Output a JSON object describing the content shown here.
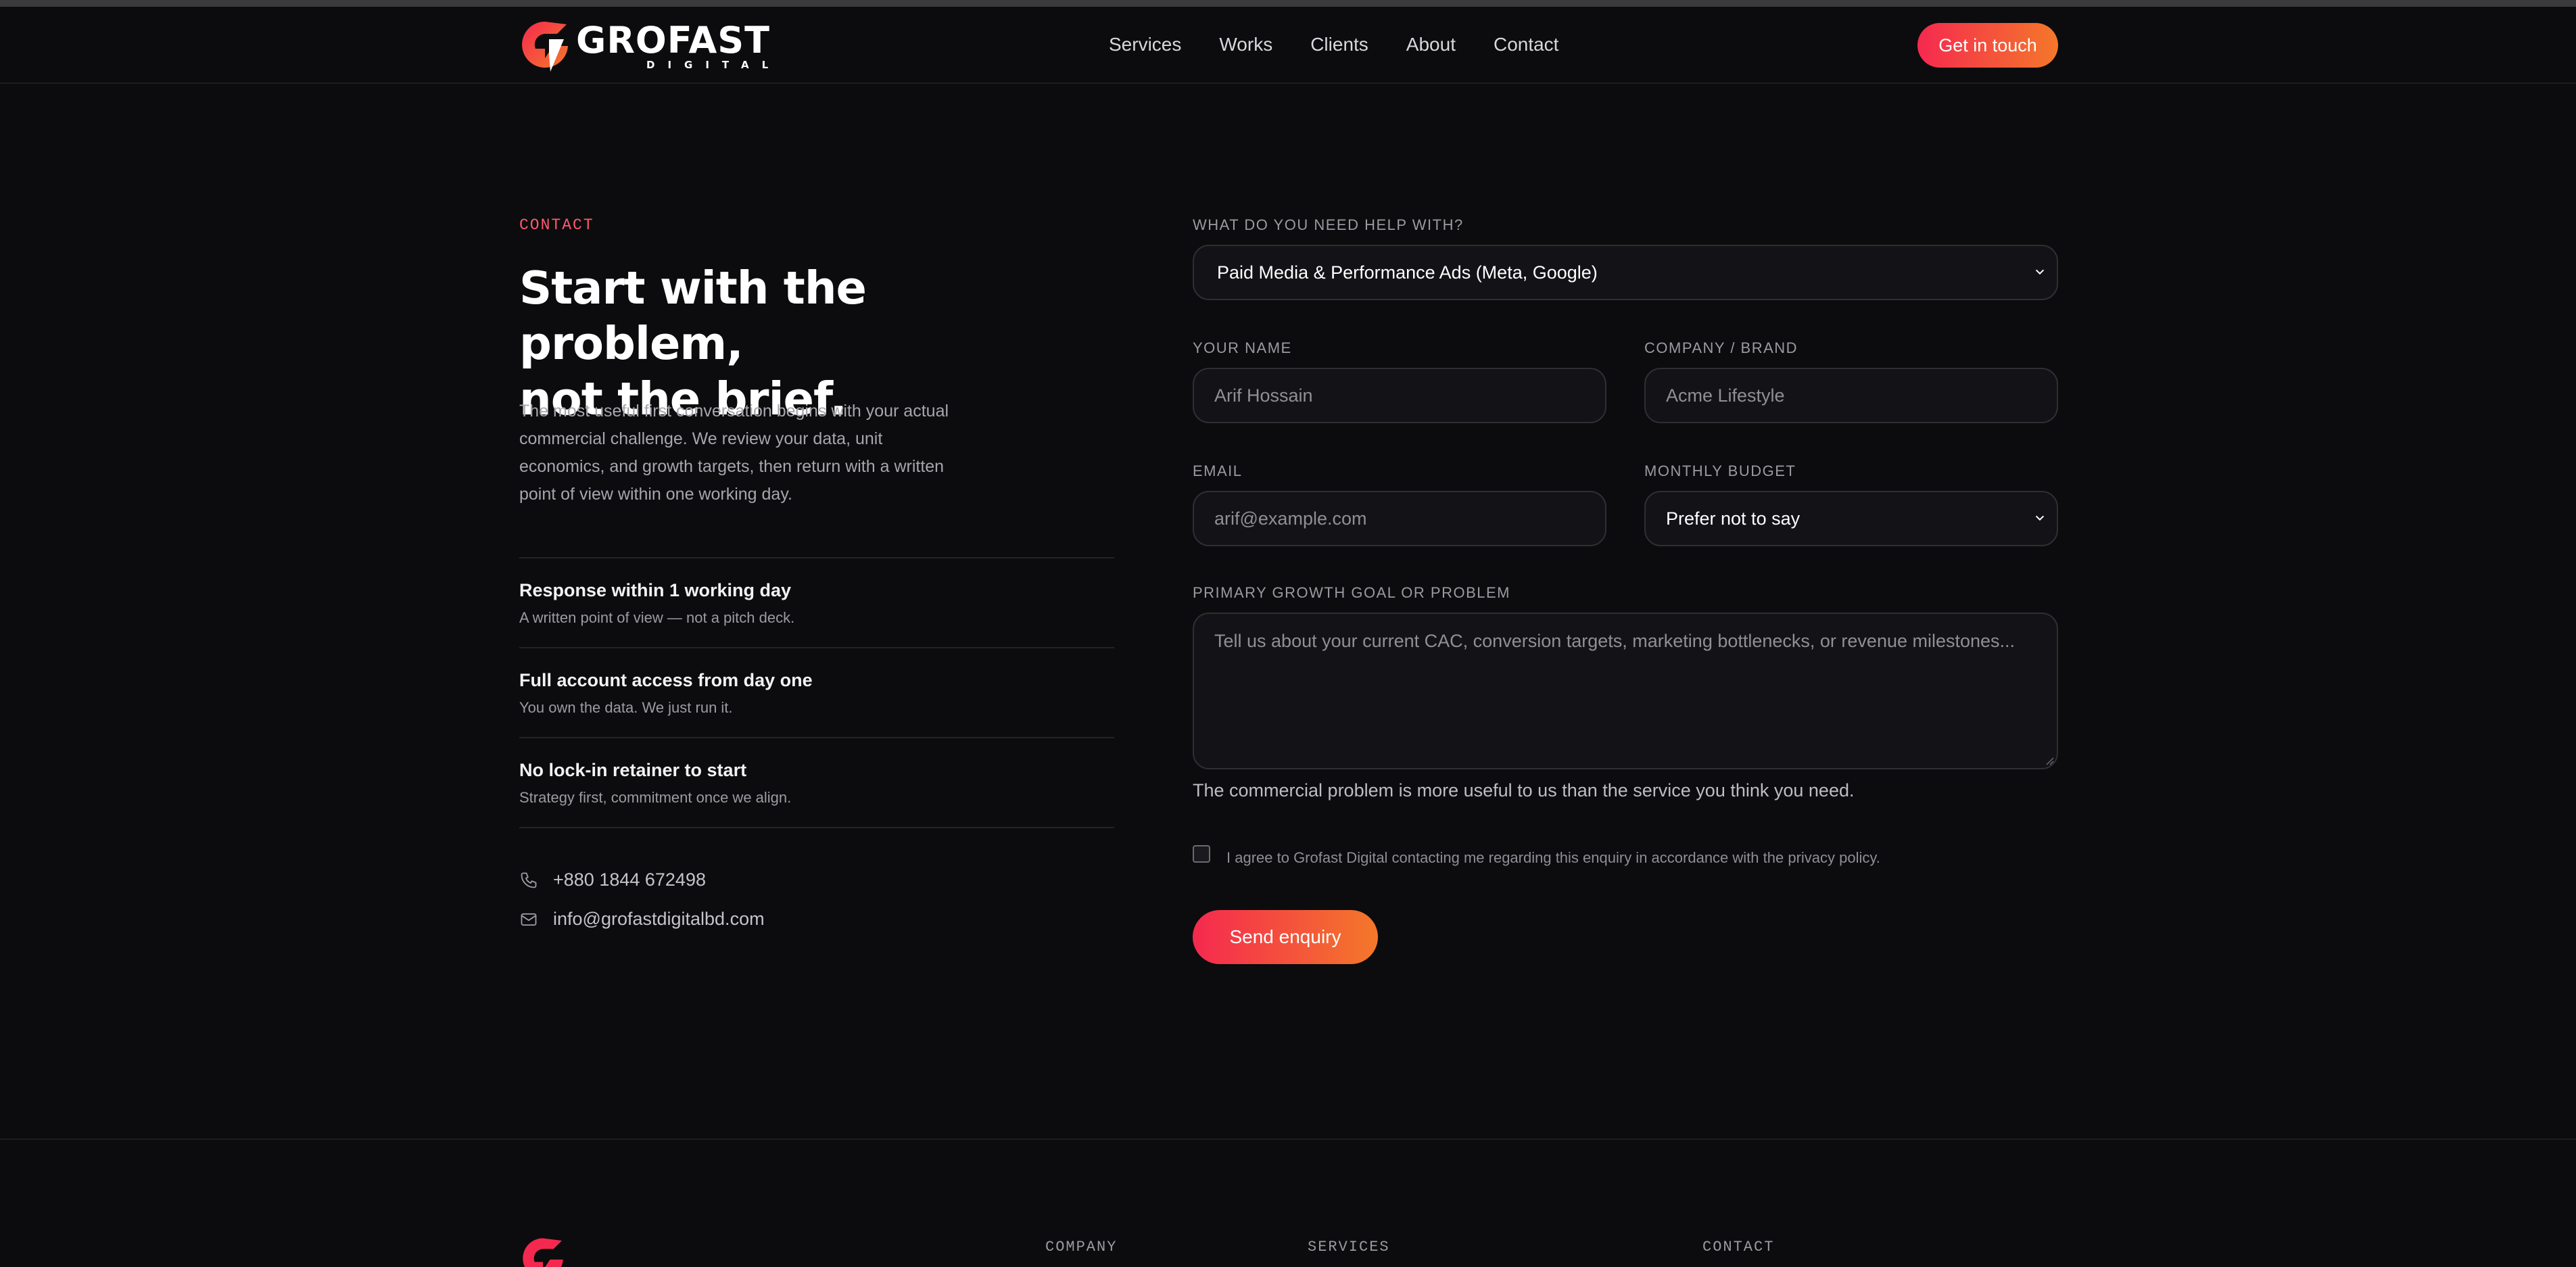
{
  "brand": {
    "name": "GROFAST",
    "sub": "DIGITAL",
    "accent_start": "#f5294f",
    "accent_end": "#f4782a"
  },
  "nav": {
    "items": [
      "Services",
      "Works",
      "Clients",
      "About",
      "Contact"
    ],
    "cta": "Get in touch"
  },
  "hero": {
    "eyebrow": "CONTACT",
    "title_line1": "Start with the problem,",
    "title_line2": "not the brief.",
    "intro": "The most useful first conversation begins with your actual commercial challenge. We review your data, unit economics, and growth targets, then return with a written point of view within one working day."
  },
  "features": [
    {
      "title": "Response within 1 working day",
      "desc": "A written point of view — not a pitch deck."
    },
    {
      "title": "Full account access from day one",
      "desc": "You own the data. We just run it."
    },
    {
      "title": "No lock-in retainer to start",
      "desc": "Strategy first, commitment once we align."
    }
  ],
  "contact": {
    "phone": "+880 1844 672498",
    "email": "info@grofastdigitalbd.com",
    "phone_icon": "phone-icon",
    "email_icon": "mail-icon"
  },
  "form": {
    "help_label": "WHAT DO YOU NEED HELP WITH?",
    "help_value": "Paid Media & Performance Ads (Meta, Google)",
    "name_label": "YOUR NAME",
    "name_placeholder": "Arif Hossain",
    "company_label": "COMPANY / BRAND",
    "company_placeholder": "Acme Lifestyle",
    "email_label": "EMAIL",
    "email_placeholder": "arif@example.com",
    "budget_label": "MONTHLY BUDGET",
    "budget_value": "Prefer not to say",
    "goal_label": "PRIMARY GROWTH GOAL OR PROBLEM",
    "goal_placeholder": "Tell us about your current CAC, conversion targets, marketing bottlenecks, or revenue milestones...",
    "helper": "The commercial problem is more useful to us than the service you think you need.",
    "consent": "I agree to Grofast Digital contacting me regarding this enquiry in accordance with the privacy policy.",
    "submit": "Send enquiry"
  },
  "footer": {
    "columns": [
      "COMPANY",
      "SERVICES",
      "CONTACT"
    ]
  }
}
